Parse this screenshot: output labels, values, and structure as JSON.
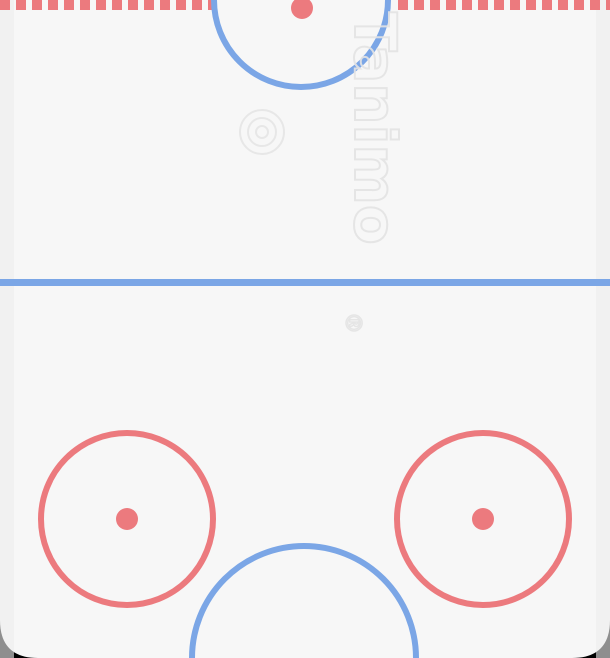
{
  "game": {
    "kind": "air-hockey-table",
    "ice_color": "#f7f7f7",
    "frame_color": "#000000",
    "blue_line_color": "#7ba6e6",
    "red_line_color": "#ec7a7e",
    "watermark_color": "#e6e6e6",
    "watermark_text": "Tanimo",
    "watermark_mark": "®"
  },
  "rink": {
    "top_goal_line": "red-dashed",
    "center_line": "blue",
    "top_goal_crease": "blue-semicircle",
    "bottom_goal_crease": "blue-semicircle",
    "faceoff_circles": [
      "left",
      "right"
    ]
  }
}
